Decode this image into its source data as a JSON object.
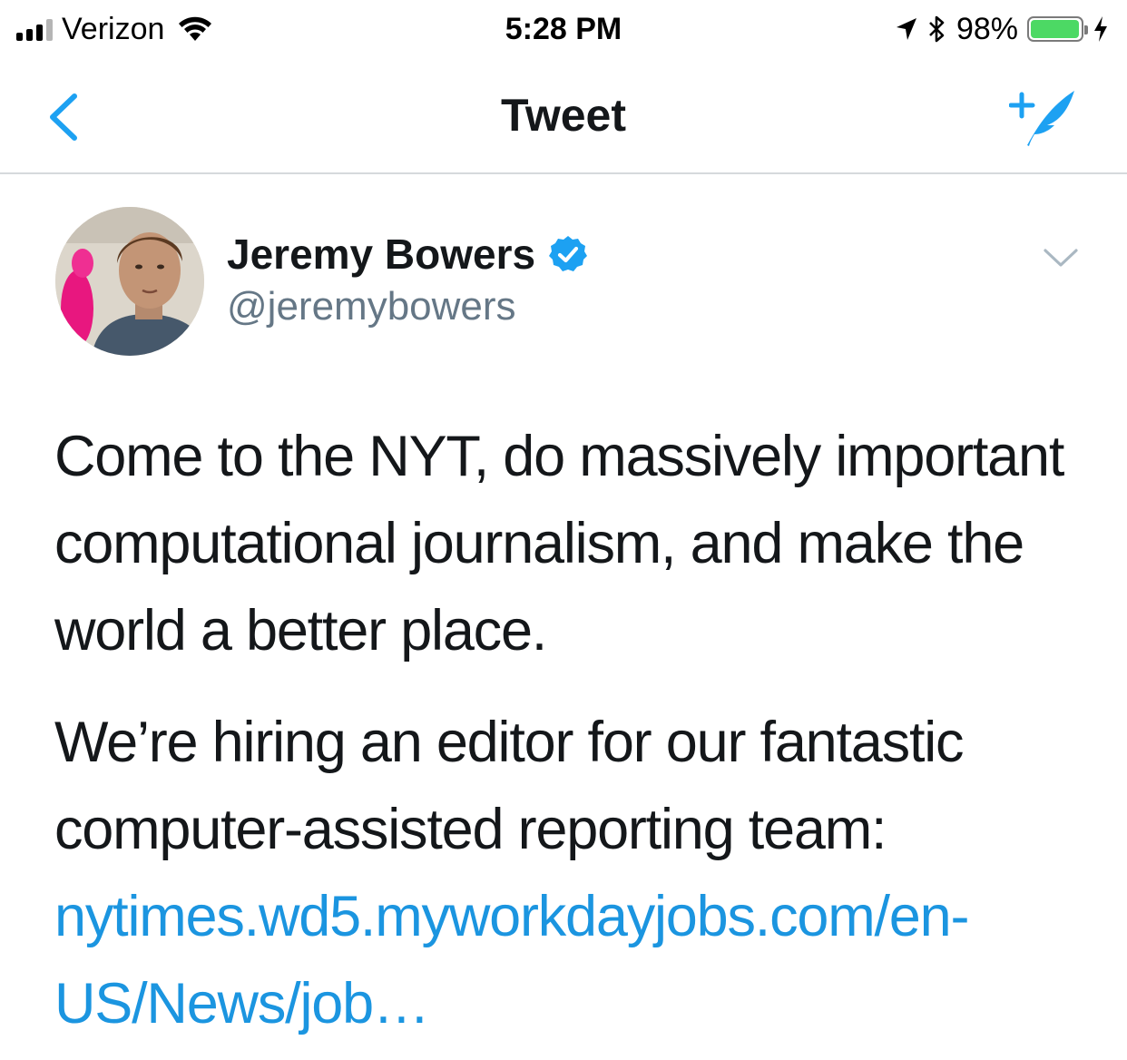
{
  "status_bar": {
    "carrier": "Verizon",
    "time": "5:28 PM",
    "battery_percent": "98%",
    "battery_level": 0.98,
    "icons": [
      "signal-icon",
      "wifi-icon",
      "location-arrow-icon",
      "bluetooth-icon",
      "battery-icon",
      "charging-icon"
    ]
  },
  "nav": {
    "title": "Tweet",
    "back_icon": "chevron-left-icon",
    "compose_icon": "compose-tweet-icon"
  },
  "tweet": {
    "author_name": "Jeremy Bowers",
    "author_handle": "@jeremybowers",
    "verified": true,
    "paragraph_1": "Come to the NYT, do massively important computational journalism, and make the world a better place.",
    "paragraph_2": "We’re hiring an editor for our fantastic computer-assisted reporting team: ",
    "link_text": "nytimes.wd5.myworkdayjobs.com/en-US/News/job…"
  },
  "colors": {
    "accent": "#1da1f2",
    "link": "#1b95e0",
    "text": "#14171a",
    "secondary_text": "#657786",
    "battery": "#4cd964"
  }
}
